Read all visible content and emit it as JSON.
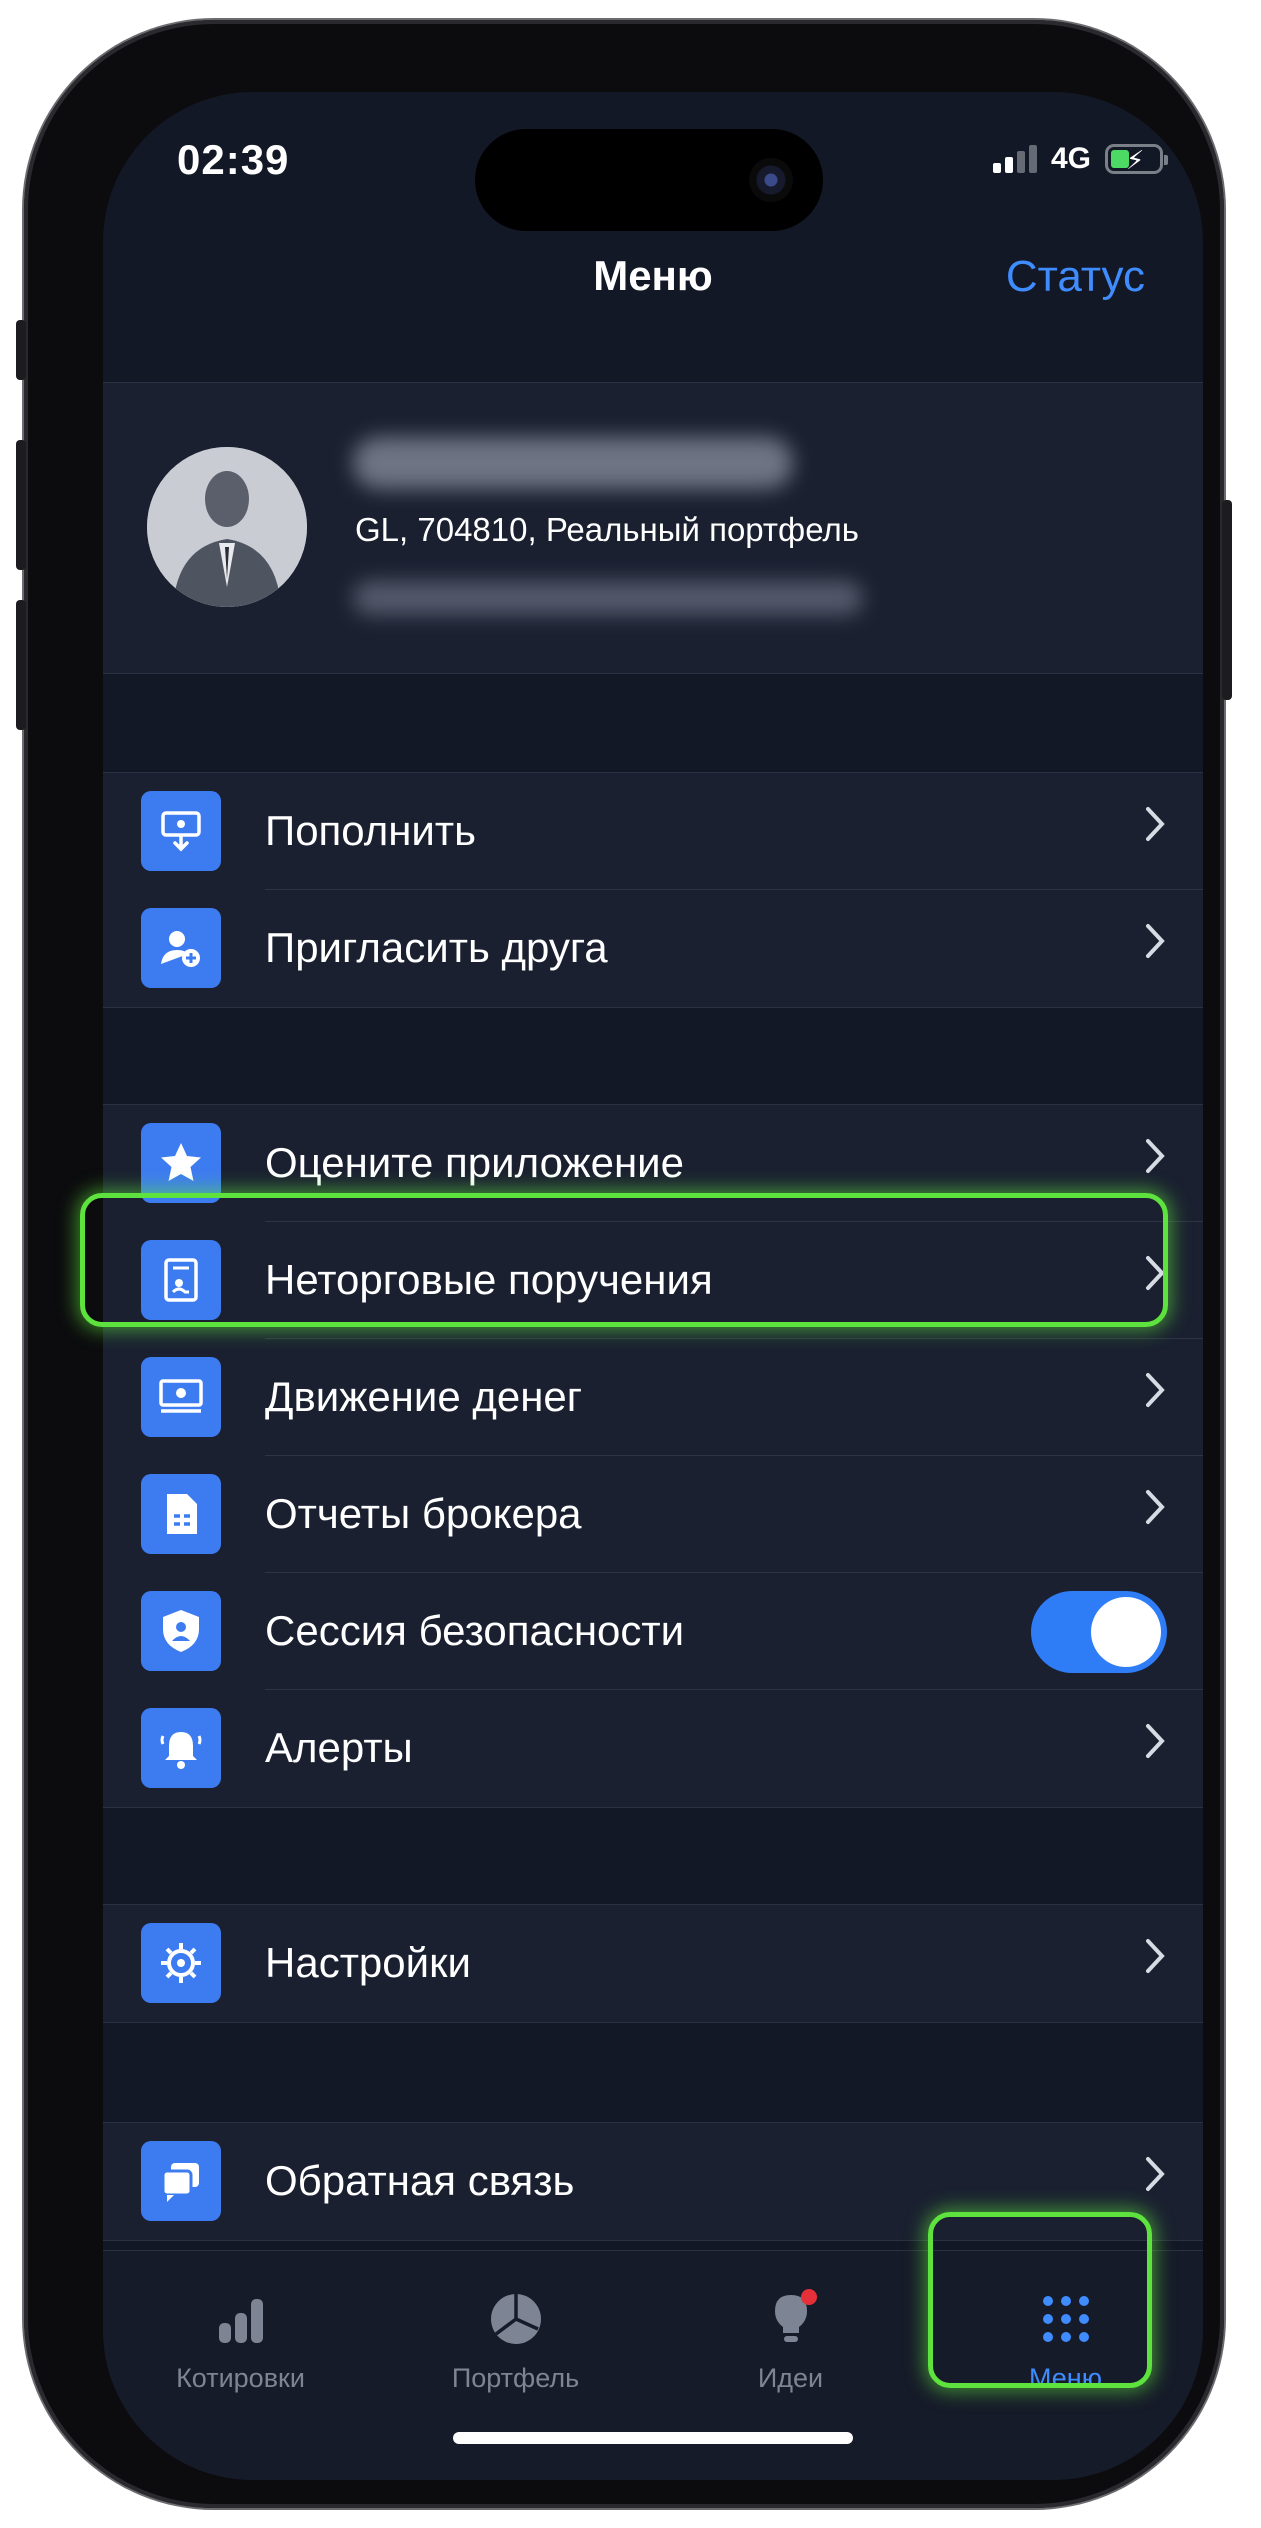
{
  "status_bar": {
    "time": "02:39",
    "network": "4G"
  },
  "nav": {
    "title": "Меню",
    "status_link": "Статус"
  },
  "profile": {
    "account_line": "GL, 704810, Реальный портфель"
  },
  "groups": [
    {
      "items": [
        {
          "label": "Пополнить",
          "icon": "deposit-icon",
          "control": "chevron"
        },
        {
          "label": "Пригласить друга",
          "icon": "invite-friend-icon",
          "control": "chevron"
        }
      ]
    },
    {
      "items": [
        {
          "label": "Оцените приложение",
          "icon": "star-icon",
          "control": "chevron"
        },
        {
          "label": "Неторговые поручения",
          "icon": "document-icon",
          "control": "chevron",
          "highlighted": true
        },
        {
          "label": "Движение денег",
          "icon": "money-icon",
          "control": "chevron"
        },
        {
          "label": "Отчеты брокера",
          "icon": "report-icon",
          "control": "chevron"
        },
        {
          "label": "Сессия безопасности",
          "icon": "shield-icon",
          "control": "toggle",
          "toggle_on": true
        },
        {
          "label": "Алерты",
          "icon": "bell-icon",
          "control": "chevron"
        }
      ]
    },
    {
      "items": [
        {
          "label": "Настройки",
          "icon": "gear-icon",
          "control": "chevron"
        }
      ]
    },
    {
      "items": [
        {
          "label": "Обратная связь",
          "icon": "feedback-icon",
          "control": "chevron"
        }
      ]
    }
  ],
  "tabbar": {
    "tabs": [
      {
        "label": "Котировки",
        "icon": "quotes-icon"
      },
      {
        "label": "Портфель",
        "icon": "pie-chart-icon"
      },
      {
        "label": "Идеи",
        "icon": "lightbulb-icon",
        "badge": true
      },
      {
        "label": "Меню",
        "icon": "grid-menu-icon",
        "active": true
      }
    ]
  },
  "colors": {
    "accent": "#3f8cff",
    "icon_bg": "#3d7cf0",
    "highlight": "#5ee23d",
    "background": "#131826",
    "card": "#1a2030"
  }
}
